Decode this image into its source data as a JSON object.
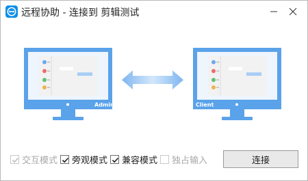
{
  "window": {
    "title": "远程协助 - 连接到 剪辑测试",
    "app_icon": "teamviewer-logo-icon",
    "minimize_icon": "minimize-icon",
    "close_icon": "close-icon"
  },
  "stage": {
    "left_monitor_label": "Admin",
    "right_monitor_label": "Client",
    "arrow_icon": "double-arrow-icon",
    "colors": {
      "monitor_blue": "#5aa2ea",
      "screen_bg": "#eef5fd",
      "panel_bg": "#f2f2f2",
      "highlight_blue": "#a9cdf5",
      "dot_blue": "#6aa9ef",
      "dot_red": "#ef6b6b",
      "dot_green": "#5cc36f",
      "dot_orange": "#f0b24e"
    }
  },
  "options": [
    {
      "label": "交互模式",
      "checked": true,
      "disabled": true
    },
    {
      "label": "旁观模式",
      "checked": true,
      "disabled": false
    },
    {
      "label": "兼容模式",
      "checked": true,
      "disabled": false
    },
    {
      "label": "独占输入",
      "checked": false,
      "disabled": true
    }
  ],
  "connect_button": {
    "label": "连接"
  }
}
